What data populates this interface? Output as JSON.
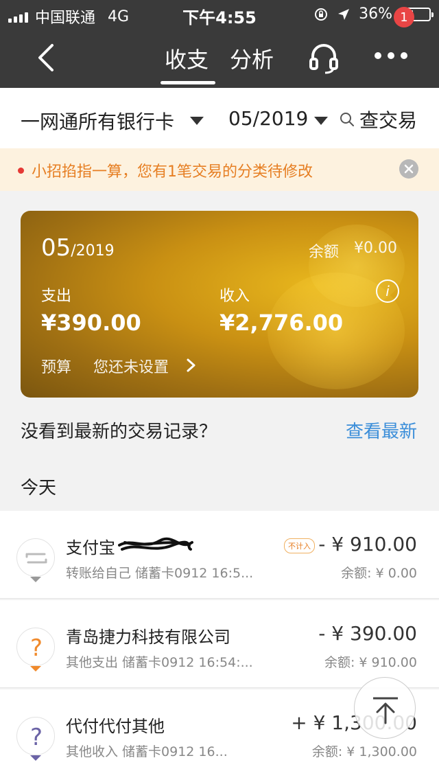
{
  "status": {
    "carrier": "中国联通",
    "network": "4G",
    "time": "下午4:55",
    "battery": "36%"
  },
  "nav": {
    "tabs": [
      {
        "label": "收支"
      },
      {
        "label": "分析"
      }
    ],
    "badge_count": "1"
  },
  "filter": {
    "account": "一网通所有银行卡",
    "month": "05/2019",
    "search_label": "查交易"
  },
  "notice": {
    "text": "小招掐指一算，您有1笔交易的分类待修改"
  },
  "summary": {
    "month": "05",
    "year": "/2019",
    "balance_label": "余额",
    "balance_value": "¥0.00",
    "expense_label": "支出",
    "expense_value": "¥390.00",
    "income_label": "收入",
    "income_value": "¥2,776.00",
    "budget_label": "预算",
    "budget_value": "您还未设置"
  },
  "prompt": {
    "text": "没看到最新的交易记录？",
    "link": "查看最新"
  },
  "section_label": "今天",
  "transactions": [
    {
      "name": "支付宝",
      "tag": "不计入",
      "sub": "转账给自己  储蓄卡0912 16:5...",
      "amount": "- ¥  910.00",
      "balance": "余额: ¥ 0.00"
    },
    {
      "name": "青岛捷力科技有限公司",
      "sub": "其他支出  储蓄卡0912 16:54:...",
      "amount": "- ¥  390.00",
      "balance": "余额: ¥ 910.00"
    },
    {
      "name": "代付代付其他",
      "sub": "其他收入  储蓄卡0912 16...",
      "amount": "+ ¥  1,300.00",
      "balance": "余额: ¥ 1,300.00"
    }
  ],
  "colors": {
    "topbar": "#3a3a3a",
    "accent_link": "#3b8ed9",
    "notice_text": "#e67e22",
    "badge": "#e94545"
  }
}
